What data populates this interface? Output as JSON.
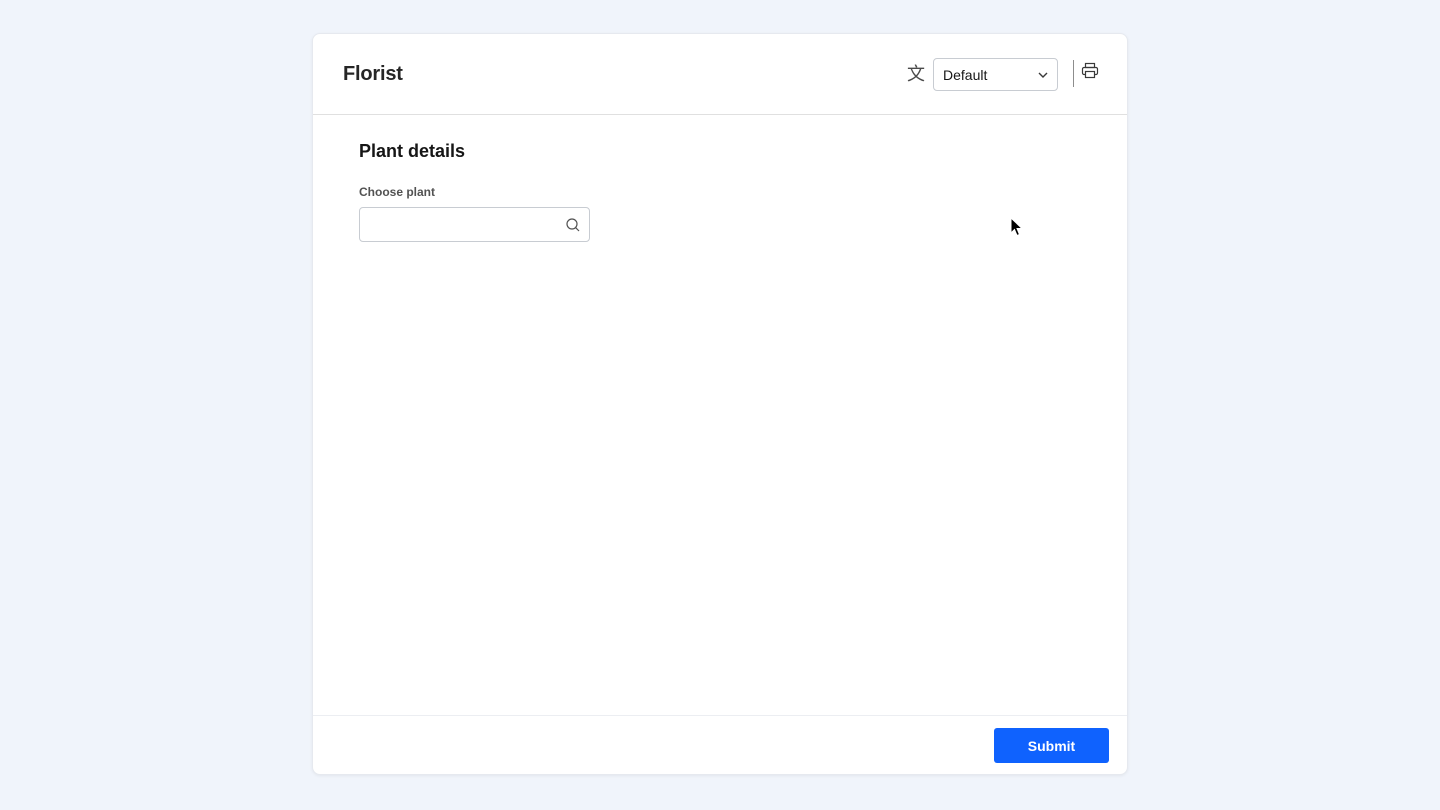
{
  "header": {
    "title": "Florist",
    "language_icon": "translate-icon",
    "language_select": {
      "value": "Default"
    },
    "print_icon": "printer-icon"
  },
  "form": {
    "section_title": "Plant details",
    "plant_field": {
      "label": "Choose plant",
      "value": "",
      "icon": "search-icon"
    }
  },
  "footer": {
    "submit_label": "Submit"
  },
  "colors": {
    "background": "#f0f4fb",
    "accent": "#0f62fe"
  }
}
